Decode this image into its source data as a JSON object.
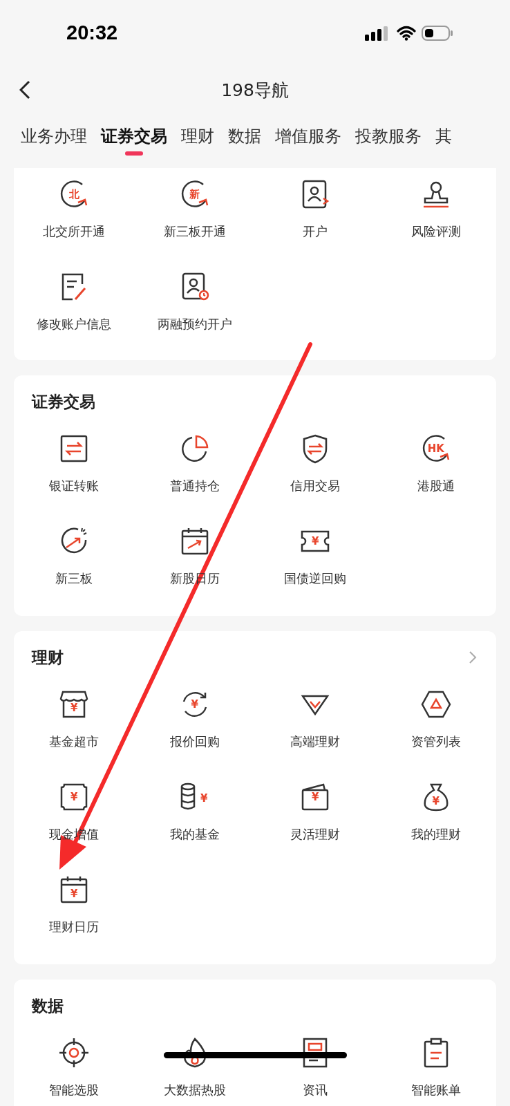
{
  "status_bar": {
    "time": "20:32"
  },
  "nav": {
    "title": "198导航"
  },
  "tabs": [
    {
      "label": "业务办理",
      "selected": false
    },
    {
      "label": "证券交易",
      "selected": true
    },
    {
      "label": "理财",
      "selected": false
    },
    {
      "label": "数据",
      "selected": false
    },
    {
      "label": "增值服务",
      "selected": false
    },
    {
      "label": "投教服务",
      "selected": false
    },
    {
      "label": "其",
      "selected": false
    }
  ],
  "sections": [
    {
      "items": [
        {
          "label": "北交所开通",
          "kind": "cycle",
          "glyph": "北"
        },
        {
          "label": "新三板开通",
          "kind": "cycle",
          "glyph": "新"
        },
        {
          "label": "开户",
          "kind": "idcard"
        },
        {
          "label": "风险评测",
          "kind": "seal"
        },
        {
          "label": "修改账户信息",
          "kind": "docedit"
        },
        {
          "label": "两融预约开户",
          "kind": "idclock"
        }
      ]
    },
    {
      "title": "证券交易",
      "items": [
        {
          "label": "银证转账",
          "kind": "transfer"
        },
        {
          "label": "普通持仓",
          "kind": "pie"
        },
        {
          "label": "信用交易",
          "kind": "shield"
        },
        {
          "label": "港股通",
          "kind": "cycle",
          "glyph": "HK"
        },
        {
          "label": "新三板",
          "kind": "growth"
        },
        {
          "label": "新股日历",
          "kind": "calarrow"
        },
        {
          "label": "国债逆回购",
          "kind": "ticket",
          "glyph": "¥"
        }
      ]
    },
    {
      "title": "理财",
      "has_more": true,
      "items": [
        {
          "label": "基金超市",
          "kind": "shop",
          "glyph": "¥"
        },
        {
          "label": "报价回购",
          "kind": "cycle2",
          "glyph": "¥"
        },
        {
          "label": "高端理财",
          "kind": "diamond"
        },
        {
          "label": "资管列表",
          "kind": "hexagon"
        },
        {
          "label": "现金增值",
          "kind": "frame",
          "glyph": "¥"
        },
        {
          "label": "我的基金",
          "kind": "coins",
          "glyph": "¥"
        },
        {
          "label": "灵活理财",
          "kind": "wallet",
          "glyph": "¥"
        },
        {
          "label": "我的理财",
          "kind": "bag",
          "glyph": "¥"
        },
        {
          "label": "理财日历",
          "kind": "calendar",
          "glyph": "¥"
        }
      ]
    },
    {
      "title": "数据",
      "items": [
        {
          "label": "智能选股",
          "kind": "target"
        },
        {
          "label": "大数据热股",
          "kind": "flame"
        },
        {
          "label": "资讯",
          "kind": "news"
        },
        {
          "label": "智能账单",
          "kind": "clipboard"
        }
      ]
    }
  ]
}
